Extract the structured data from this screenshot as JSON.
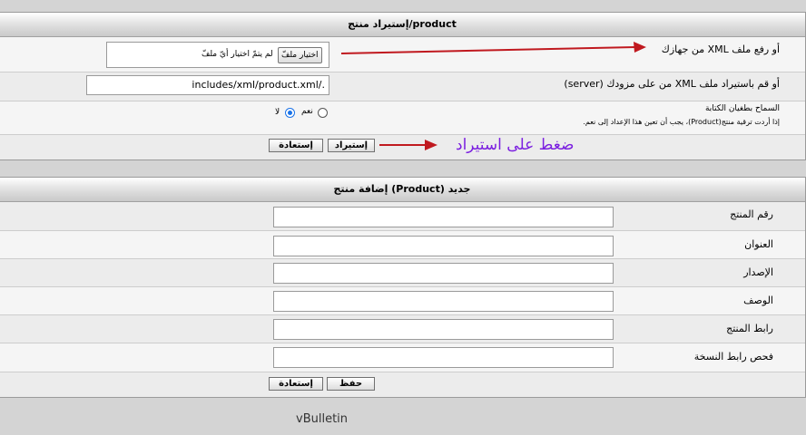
{
  "import_panel": {
    "title": "إستيراد منتج/product",
    "upload_label": "أو رفع ملف XML من جهازك",
    "file_button": "اختيار ملفّ",
    "file_status": "لم يتمّ اختيار أيّ ملفّ",
    "server_label": "أو قم باستيراد ملف XML من على مزودك (server)",
    "server_path_value": "includes/xml/product.xml/.",
    "overwrite_label": "السماح بطغيان الكتابة",
    "overwrite_hint": "إذا أردت ترقية منتج(Product)، يجب أن تعين هذا الإعداد إلى نعم.",
    "radio_yes": "نعم",
    "radio_no": "لا",
    "import_button": "إستيراد",
    "reset_button": "إستعادة",
    "annotation": "ضغط على استيراد",
    "annotation_color": "#7b1fe0",
    "arrow_color": "#c0191f"
  },
  "add_panel": {
    "title": "إضافة منتج (Product) جديد",
    "fields": [
      {
        "label": "رقم المنتج",
        "value": ""
      },
      {
        "label": "العنوان",
        "value": ""
      },
      {
        "label": "الإصدار",
        "value": ""
      },
      {
        "label": "الوصف",
        "value": ""
      },
      {
        "label": "رابط المنتج",
        "value": ""
      },
      {
        "label": "فحص رابط النسخة",
        "value": ""
      }
    ],
    "save_button": "حفظ",
    "reset_button": "إستعادة"
  },
  "footer": "vBulletin"
}
